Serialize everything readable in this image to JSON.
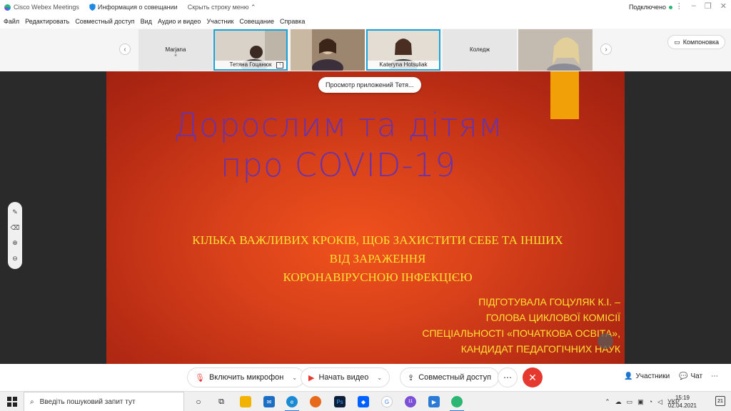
{
  "titlebar": {
    "app_name": "Cisco Webex Meetings",
    "meeting_info": "Информация о совещании",
    "hide_menu": "Скрыть строку меню",
    "status": "Подключено"
  },
  "menu": [
    "Файл",
    "Редактировать",
    "Совместный доступ",
    "Вид",
    "Аудио и видео",
    "Участник",
    "Совещание",
    "Справка"
  ],
  "participants": [
    {
      "name": "Marjana",
      "sub": "я",
      "video": false,
      "active": false
    },
    {
      "name": "Тетяна Гоцанюк",
      "video": true,
      "active": true,
      "sharing": true
    },
    {
      "name": "",
      "video": true,
      "active": false
    },
    {
      "name": "Kateryna Hotsuliak",
      "video": true,
      "active": true
    },
    {
      "name": "Коледж",
      "video": false,
      "active": false
    },
    {
      "name": "",
      "video": true,
      "active": false
    }
  ],
  "layout_button": "Компоновка",
  "apps_pill": "Просмотр приложений Тетя...",
  "slide": {
    "title_line1": "Дорослим та дітям",
    "title_line2": "про COVID-19",
    "sub_line1": "КІЛЬКА ВАЖЛИВИХ КРОКІВ, ЩОБ ЗАХИСТИТИ СЕБЕ ТА ІНШИХ",
    "sub_line2": "ВІД ЗАРАЖЕННЯ",
    "sub_line3": "КОРОНАВІРУСНОЮ ІНФЕКЦІЄЮ",
    "author_line1": "ПІДГОТУВАЛА ГОЦУЛЯК К.І. –",
    "author_line2": "ГОЛОВА ЦИКЛОВОЇ КОМІСІЇ",
    "author_line3": "СПЕЦІАЛЬНОСТІ «ПОЧАТКОВА ОСВІТА»,",
    "author_line4": "КАНДИДАТ ПЕДАГОГІЧНИХ НАУК",
    "colors": {
      "title": "#6b33a8",
      "text": "#ffe033",
      "accent_bar": "#f2a007"
    }
  },
  "controls": {
    "mic": "Включить микрофон",
    "video": "Начать видео",
    "share": "Совместный доступ",
    "participants": "Участники",
    "chat": "Чат"
  },
  "taskbar": {
    "search_placeholder": "Введіть пошуковий запит тут",
    "language": "УКР",
    "time": "15:19",
    "date": "02.04.2021",
    "notifications": "21",
    "viber_badge": "11"
  }
}
